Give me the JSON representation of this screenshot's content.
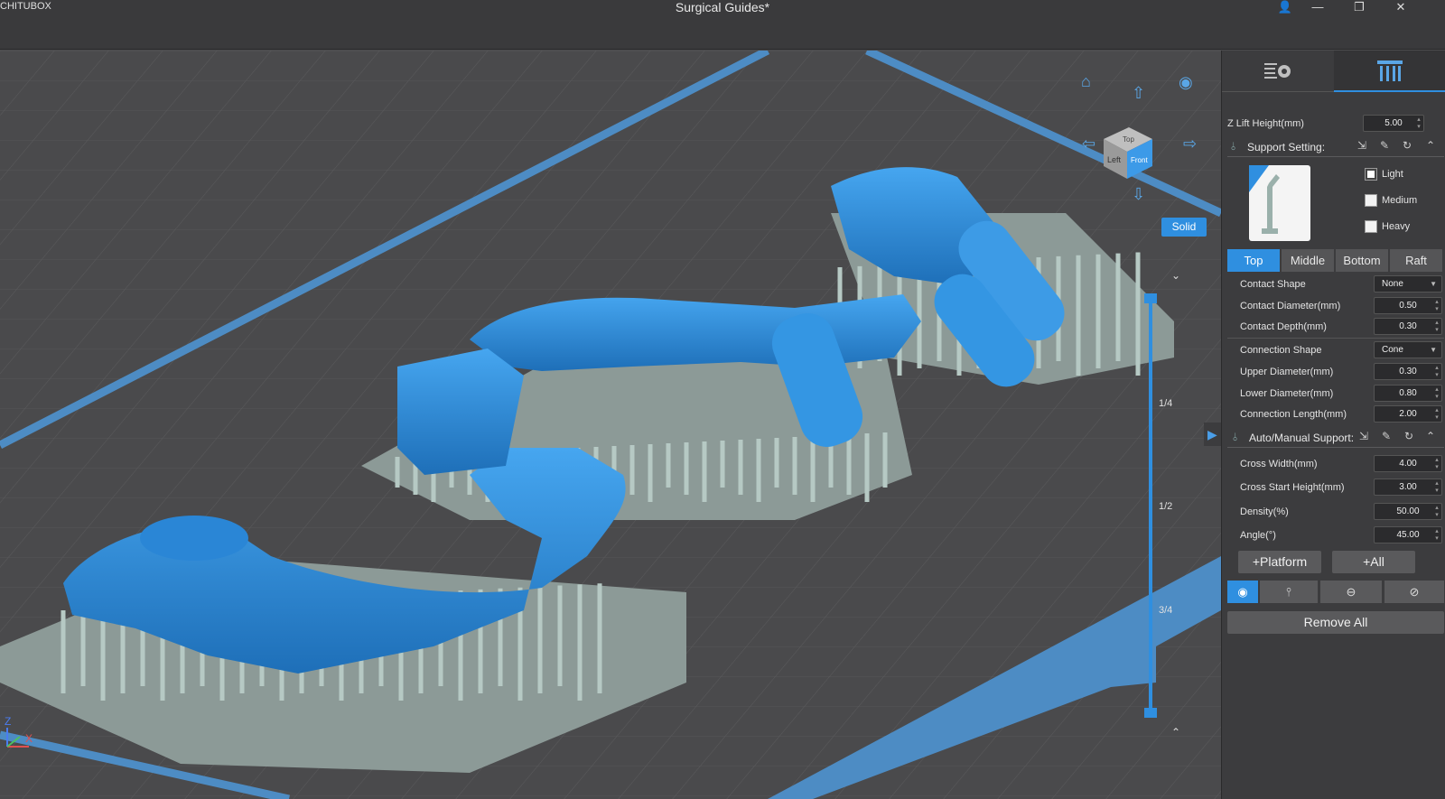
{
  "app": {
    "name": "CHITUBOX",
    "document_title": "Surgical Guides*"
  },
  "window_controls": {
    "user": "👤",
    "minimize": "—",
    "restore": "❐",
    "close": "✕"
  },
  "viewport": {
    "solid_button": "Solid",
    "view_cube": {
      "top": "Top",
      "left": "Left",
      "front": "Front"
    },
    "slider_labels": [
      "1/4",
      "1/2",
      "3/4"
    ],
    "axis_labels": {
      "z": "Z",
      "x": "X"
    },
    "colors": {
      "model": "#2f8fe0",
      "support": "#a9bdb8",
      "raft": "#8c9a97",
      "platform_border": "#4d8cc4"
    }
  },
  "panel": {
    "tabs": [
      {
        "name": "settings-tab",
        "icon": "settings-list-icon",
        "active": false
      },
      {
        "name": "support-tab",
        "icon": "support-table-icon",
        "active": true
      }
    ],
    "z_lift": {
      "label": "Z Lift Height(mm)",
      "value": "5.00"
    },
    "support_setting": {
      "title": "Support Setting:",
      "presets": [
        {
          "label": "Light",
          "checked": true
        },
        {
          "label": "Medium",
          "checked": false
        },
        {
          "label": "Heavy",
          "checked": false
        }
      ],
      "subtabs": [
        "Top",
        "Middle",
        "Bottom",
        "Raft"
      ],
      "active_subtab": "Top",
      "fields": [
        {
          "label": "Contact Shape",
          "value": "None",
          "type": "select"
        },
        {
          "label": "Contact Diameter(mm)",
          "value": "0.50",
          "type": "number"
        },
        {
          "label": "Contact Depth(mm)",
          "value": "0.30",
          "type": "number"
        },
        {
          "label": "Connection Shape",
          "value": "Cone",
          "type": "select"
        },
        {
          "label": "Upper Diameter(mm)",
          "value": "0.30",
          "type": "number"
        },
        {
          "label": "Lower Diameter(mm)",
          "value": "0.80",
          "type": "number"
        },
        {
          "label": "Connection Length(mm)",
          "value": "2.00",
          "type": "number"
        }
      ]
    },
    "auto_manual": {
      "title": "Auto/Manual Support:",
      "fields": [
        {
          "label": "Cross Width(mm)",
          "value": "4.00"
        },
        {
          "label": "Cross Start Height(mm)",
          "value": "3.00"
        },
        {
          "label": "Density(%)",
          "value": "50.00"
        },
        {
          "label": "Angle(°)",
          "value": "45.00"
        }
      ],
      "platform_button": "+Platform",
      "all_button": "+All",
      "remove_all_button": "Remove All"
    }
  }
}
